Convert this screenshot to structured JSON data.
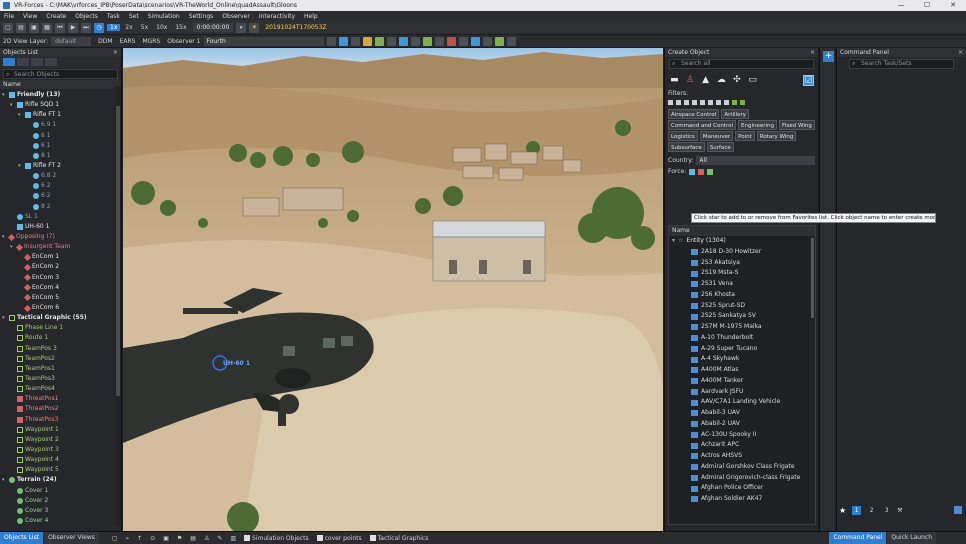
{
  "window": {
    "title": "VR-Forces - C:\\MAK\\vrforces_IPB\\PoserData\\scenarios\\VR-TheWorld_Online\\quadAssault\\Gloons"
  },
  "menu": [
    "File",
    "View",
    "Create",
    "Objects",
    "Task",
    "Set",
    "Simulation",
    "Settings",
    "Observer",
    "Interactivity",
    "Help"
  ],
  "toolbar": {
    "speeds": [
      "1x",
      "2x",
      "5x",
      "10x",
      "15x"
    ],
    "selected_speed": "1x",
    "clock": "0:00:00:00",
    "datetime": "20191024T170053Z",
    "view_layer_label": "2D View Layer:",
    "view_layer_value": "default",
    "coord_modes": [
      "DDM",
      "EARS",
      "MGRS"
    ],
    "observer_label": "Observer 1",
    "observer_value": "Fourth"
  },
  "objects_list": {
    "title": "Objects List",
    "search_placeholder": "Search Objects",
    "col_name": "Name",
    "tree": [
      {
        "level": 0,
        "arrow": "▾",
        "sym": "fr",
        "text": "Friendly (13)",
        "cls": "t-friend"
      },
      {
        "level": 1,
        "arrow": "▾",
        "sym": "fr",
        "text": "Rifle SQD 1",
        "cls": "t-white"
      },
      {
        "level": 2,
        "arrow": "▾",
        "sym": "fr",
        "text": "Rifle FT 1",
        "cls": "t-white"
      },
      {
        "level": 3,
        "arrow": "",
        "sym": "circ",
        "text": "6.9 1",
        "cls": "t-dim"
      },
      {
        "level": 3,
        "arrow": "",
        "sym": "circ",
        "text": "6 1",
        "cls": "t-dim"
      },
      {
        "level": 3,
        "arrow": "",
        "sym": "circ",
        "text": "6 1",
        "cls": "t-dim"
      },
      {
        "level": 3,
        "arrow": "",
        "sym": "circ",
        "text": "8 1",
        "cls": "t-dim"
      },
      {
        "level": 2,
        "arrow": "▾",
        "sym": "fr",
        "text": "Rifle FT 2",
        "cls": "t-white"
      },
      {
        "level": 3,
        "arrow": "",
        "sym": "circ",
        "text": "6.8 2",
        "cls": "t-dim"
      },
      {
        "level": 3,
        "arrow": "",
        "sym": "circ",
        "text": "6 2",
        "cls": "t-dim"
      },
      {
        "level": 3,
        "arrow": "",
        "sym": "circ",
        "text": "6 2",
        "cls": "t-dim"
      },
      {
        "level": 3,
        "arrow": "",
        "sym": "circ",
        "text": "8 2",
        "cls": "t-dim"
      },
      {
        "level": 1,
        "arrow": "",
        "sym": "circ",
        "text": "SL 1",
        "cls": "t-dim"
      },
      {
        "level": 1,
        "arrow": "",
        "sym": "fr",
        "text": "UH-60 1",
        "cls": "t-white"
      },
      {
        "level": 0,
        "arrow": "▾",
        "sym": "op",
        "text": "Opposing (7)",
        "cls": "t-op"
      },
      {
        "level": 1,
        "arrow": "▾",
        "sym": "op",
        "text": "Insurgent Team",
        "cls": "t-op"
      },
      {
        "level": 2,
        "arrow": "",
        "sym": "op",
        "text": "EnCom 1",
        "cls": "t-white"
      },
      {
        "level": 2,
        "arrow": "",
        "sym": "op",
        "text": "EnCom 2",
        "cls": "t-white"
      },
      {
        "level": 2,
        "arrow": "",
        "sym": "op",
        "text": "EnCom 3",
        "cls": "t-white"
      },
      {
        "level": 2,
        "arrow": "",
        "sym": "op",
        "text": "EnCom 4",
        "cls": "t-white"
      },
      {
        "level": 2,
        "arrow": "",
        "sym": "op",
        "text": "EnCom 5",
        "cls": "t-white"
      },
      {
        "level": 2,
        "arrow": "",
        "sym": "op",
        "text": "EnCom 6",
        "cls": "t-white"
      },
      {
        "level": 0,
        "arrow": "▾",
        "sym": "tg",
        "text": "Tactical Graphic (55)",
        "cls": "t-friend"
      },
      {
        "level": 1,
        "arrow": "",
        "sym": "tg",
        "text": "Phase Line 1",
        "cls": "t-tg"
      },
      {
        "level": 1,
        "arrow": "",
        "sym": "tg",
        "text": "Route 1",
        "cls": "t-tg"
      },
      {
        "level": 1,
        "arrow": "",
        "sym": "tg",
        "text": "TeamPos 3",
        "cls": "t-tg"
      },
      {
        "level": 1,
        "arrow": "",
        "sym": "tg",
        "text": "TeamPos2",
        "cls": "t-tg"
      },
      {
        "level": 1,
        "arrow": "",
        "sym": "tg",
        "text": "TeamPos1",
        "cls": "t-tg"
      },
      {
        "level": 1,
        "arrow": "",
        "sym": "tg",
        "text": "TeamPos3",
        "cls": "t-tg"
      },
      {
        "level": 1,
        "arrow": "",
        "sym": "tg",
        "text": "TeamPos4",
        "cls": "t-tg"
      },
      {
        "level": 1,
        "arrow": "",
        "sym": "tg2",
        "text": "ThreatPos1",
        "cls": "t-op"
      },
      {
        "level": 1,
        "arrow": "",
        "sym": "tg2",
        "text": "ThreatPos2",
        "cls": "t-op"
      },
      {
        "level": 1,
        "arrow": "",
        "sym": "tg2",
        "text": "ThreatPos3",
        "cls": "t-op"
      },
      {
        "level": 1,
        "arrow": "",
        "sym": "tg",
        "text": "Waypoint 1",
        "cls": "t-tg"
      },
      {
        "level": 1,
        "arrow": "",
        "sym": "tg",
        "text": "Waypoint 2",
        "cls": "t-tg"
      },
      {
        "level": 1,
        "arrow": "",
        "sym": "tg",
        "text": "Waypoint 3",
        "cls": "t-tg"
      },
      {
        "level": 1,
        "arrow": "",
        "sym": "tg",
        "text": "Waypoint 4",
        "cls": "t-tg"
      },
      {
        "level": 1,
        "arrow": "",
        "sym": "tg",
        "text": "Waypoint 5",
        "cls": "t-tg"
      },
      {
        "level": 0,
        "arrow": "▾",
        "sym": "ter",
        "text": "Terrain (24)",
        "cls": "t-friend"
      },
      {
        "level": 1,
        "arrow": "",
        "sym": "ter",
        "text": "Cover 1",
        "cls": "t-ter"
      },
      {
        "level": 1,
        "arrow": "",
        "sym": "ter",
        "text": "Cover 2",
        "cls": "t-ter"
      },
      {
        "level": 1,
        "arrow": "",
        "sym": "ter",
        "text": "Cover 3",
        "cls": "t-ter"
      },
      {
        "level": 1,
        "arrow": "",
        "sym": "ter",
        "text": "Cover 4",
        "cls": "t-ter"
      }
    ]
  },
  "viewport": {
    "entity_label": "UH-60 1"
  },
  "create_object": {
    "title": "Create Object",
    "search_placeholder": "Search all",
    "filters_label": "Filters:",
    "filter_buttons": [
      "Airspace Control",
      "Artillery",
      "Command and Control",
      "Engineering",
      "Fixed Wing",
      "Logistics",
      "Maneuver",
      "Point",
      "Rotary Wing",
      "Subsurface",
      "Surface"
    ],
    "country_label": "Country:",
    "country_value": "All",
    "force_label": "Force:",
    "col_name": "Name",
    "category": "Entity (1304)",
    "items": [
      "2A18 D-30 Howitzer",
      "2S3 Akatsiya",
      "2S19 Msta-S",
      "2S31 Vena",
      "2S6 Khosta",
      "2S25 Sprut-SD",
      "2S25 Sankatya SV",
      "2S7M M-1975 Malka",
      "A-10 Thunderbolt",
      "A-29 Super Tucano",
      "A-4 Skyhawk",
      "A400M Atlas",
      "A400M Tanker",
      "Aardvark JSFU",
      "AAV/C7A1 Landing Vehicle",
      "Ababil-3 UAV",
      "Ababil-2 UAV",
      "AC-130U Spooky II",
      "Achzarit APC",
      "Actros AHSVS",
      "Admiral Gorshkov Class Frigate",
      "Admiral Grigorovich-class Frigate",
      "Afghan Police Officer",
      "Afghan Soldier AK47"
    ],
    "tooltip": "Click star to add to or remove from Favorites list. Click object name to enter create mode."
  },
  "command_panel": {
    "title": "Command Panel",
    "search_placeholder": "Search Task/Sets",
    "pages": [
      "1",
      "2",
      "3"
    ]
  },
  "bottom": {
    "left_tabs": [
      "Objects List",
      "Observer Views"
    ],
    "checks": [
      "Simulation Objects",
      "cover points",
      "Tactical Graphics"
    ],
    "right_tabs": [
      "Command Panel",
      "Quick Launch"
    ]
  }
}
